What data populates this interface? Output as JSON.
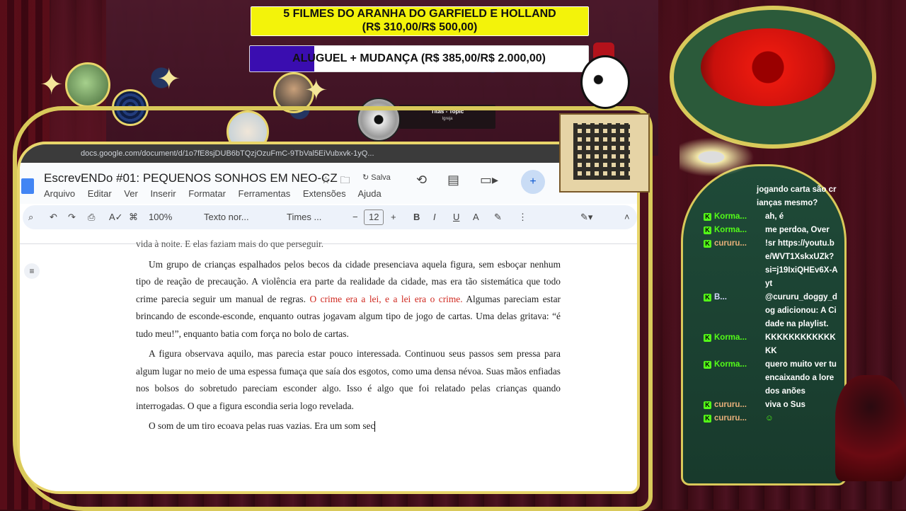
{
  "goals": [
    {
      "title": "5 FILMES DO ARANHA DO GARFIELD E HOLLAND",
      "amount": "(R$ 310,00/R$ 500,00)",
      "progress": 0.62
    },
    {
      "title": "ALUGUEL + MUDANÇA (R$ 385,00/R$ 2.000,00)",
      "progress": 0.19
    }
  ],
  "now_playing": {
    "title": "Titãs - Topic",
    "subtitle": "Igreja"
  },
  "browser": {
    "url": "docs.google.com/document/d/1o7fE8sjDUB6bTQzjOzuFmC-9TbVal5EiVubxvk-1yQ..."
  },
  "doc": {
    "title": "EscrevENDo #01: PEQUENOS SONHOS EM NEO-CZ",
    "saved_label": "Salva",
    "menu": [
      "Arquivo",
      "Editar",
      "Ver",
      "Inserir",
      "Formatar",
      "Ferramentas",
      "Extensões",
      "Ajuda"
    ],
    "toolbar": {
      "zoom": "100%",
      "style": "Texto nor...",
      "font": "Times ...",
      "font_size": "12"
    },
    "paragraphs": {
      "p0": "vida à noite. E elas faziam mais do que perseguir.",
      "p1_a": "Um grupo de crianças espalhados pelos becos da cidade presenciava aquela figura, sem esboçar nenhum tipo de reação de precaução. A violência era parte da realidade da cidade, mas era tão sistemática que todo crime parecia seguir um manual de regras. ",
      "p1_red": "O crime era a lei, e a lei era o crime.",
      "p1_b": " Algumas pareciam estar brincando de esconde-esconde, enquanto outras jogavam algum tipo de jogo de cartas. Uma delas gritava: “é tudo meu!”, enquanto batia com força no bolo de cartas.",
      "p2": "A figura observava aquilo, mas parecia estar pouco interessada. Continuou seus passos sem pressa para algum lugar no meio de uma espessa fumaça que saía dos esgotos, como uma densa névoa. Suas mãos enfiadas nos bolsos do sobretudo pareciam esconder algo. Isso é algo que foi relatado pelas crianças quando interrogadas. O que a figura escondia seria logo revelada.",
      "p3": "O som de um tiro ecoava pelas ruas vazias. Era um som sec"
    }
  },
  "chat": {
    "accent": "#53fc18",
    "messages": [
      {
        "user": "",
        "text": "jogando carta são crianças mesmo?"
      },
      {
        "user": "Korma...",
        "text": "ah, é"
      },
      {
        "user": "Korma...",
        "text": "me perdoa, Over"
      },
      {
        "user": "cururu...",
        "text": "!sr https://youtu.be/WVT1XskxUZk?si=j19IxiQHEv6X-Ayt"
      },
      {
        "user": "B...",
        "text": "@cururu_doggy_dog adicionou: A Cidade na playlist."
      },
      {
        "user": "Korma...",
        "text": "KKKKKKKKKKKKKK"
      },
      {
        "user": "Korma...",
        "text": "quero muito ver tu encaixando a lore dos anões"
      },
      {
        "user": "cururu...",
        "text": "viva o Sus"
      },
      {
        "user": "cururu...",
        "text": "☺"
      }
    ]
  }
}
